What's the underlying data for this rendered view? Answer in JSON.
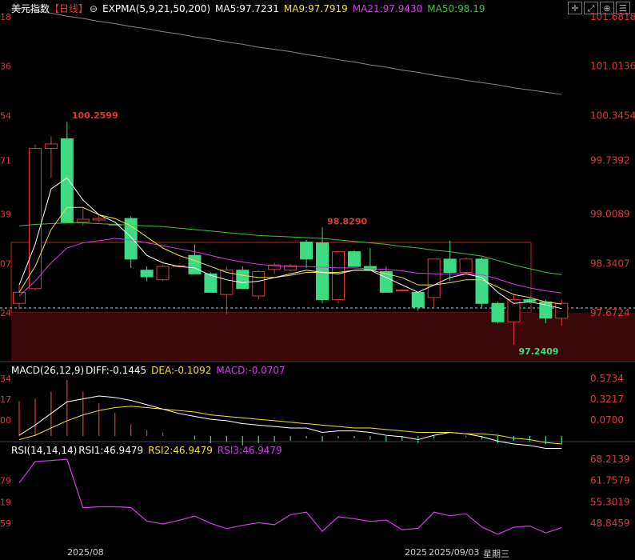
{
  "header": {
    "symbol": "美元指数",
    "period": "【日线】",
    "toggle_icon": "circle-minus-icon",
    "ema_label": "EXPMA(5,9,21,50,200)",
    "ma5": "MA5:97.7231",
    "ma9": "MA9:97.7919",
    "ma21": "MA21:97.9430",
    "ma50": "MA50:98.19"
  },
  "window_controls": {
    "icons": [
      "crosshair-icon",
      "expand-icon",
      "zoom-icon",
      "menu-icon"
    ]
  },
  "macd_header": {
    "label": "MACD(26,12,9)",
    "diff": "DIFF:-0.1445",
    "dea": "DEA:-0.1092",
    "macd": "MACD:-0.0707"
  },
  "rsi_header": {
    "label": "RSI(14,14,14)",
    "rsi1": "RSI1:46.9479",
    "rsi2": "RSI2:46.9479",
    "rsi3": "RSI3:46.9479"
  },
  "colors": {
    "up": "#e0393b",
    "down": "#3ddc84",
    "ma5": "#ffffff",
    "ma9": "#f0e040",
    "ma21": "#d040e0",
    "ma50": "#40c040",
    "ema200": "#888888",
    "axis": "#e0393b"
  },
  "chart_data": [
    {
      "type": "candlestick",
      "y_ticks": [
        "101.6818",
        "101.0136",
        "100.3454",
        "99.7392",
        "99.0089",
        "98.3407",
        "97.6724"
      ],
      "left_ticks": [
        "18",
        "36",
        "54",
        "71",
        "39",
        "07",
        "24"
      ],
      "current_price": "97.7392",
      "annotations": [
        "100.2599",
        "98.8290",
        "97.2409"
      ],
      "ohlc": [
        [
          97.8,
          98.05,
          97.72,
          97.95
        ],
        [
          98.0,
          99.95,
          97.98,
          99.9
        ],
        [
          99.9,
          100.06,
          99.5,
          99.96
        ],
        [
          100.03,
          100.26,
          98.9,
          98.9
        ],
        [
          98.9,
          99.1,
          98.85,
          98.94
        ],
        [
          98.93,
          99.0,
          98.9,
          98.95
        ],
        [
          98.86,
          98.88,
          98.86,
          98.87
        ],
        [
          98.95,
          98.98,
          98.28,
          98.4
        ],
        [
          98.25,
          98.3,
          98.1,
          98.16
        ],
        [
          98.12,
          98.32,
          98.1,
          98.3
        ],
        [
          98.3,
          98.32,
          98.29,
          98.31
        ],
        [
          98.45,
          98.6,
          98.2,
          98.2
        ],
        [
          98.2,
          98.22,
          97.95,
          97.95
        ],
        [
          97.92,
          98.3,
          97.65,
          98.25
        ],
        [
          98.25,
          98.3,
          98.0,
          98.0
        ],
        [
          97.9,
          98.25,
          97.85,
          98.23
        ],
        [
          98.26,
          98.35,
          98.2,
          98.32
        ],
        [
          98.25,
          98.33,
          98.23,
          98.31
        ],
        [
          98.63,
          98.66,
          98.28,
          98.4
        ],
        [
          98.62,
          98.83,
          97.8,
          97.85
        ],
        [
          97.85,
          98.5,
          97.8,
          98.5
        ],
        [
          98.5,
          98.52,
          98.3,
          98.3
        ],
        [
          98.3,
          98.55,
          98.25,
          98.25
        ],
        [
          98.23,
          98.3,
          97.95,
          97.95
        ],
        [
          97.97,
          97.99,
          97.96,
          97.98
        ],
        [
          97.95,
          97.95,
          97.7,
          97.75
        ],
        [
          97.88,
          98.4,
          97.75,
          98.4
        ],
        [
          98.4,
          98.65,
          98.1,
          98.22
        ],
        [
          98.22,
          98.42,
          98.2,
          98.4
        ],
        [
          98.4,
          98.42,
          97.75,
          97.8
        ],
        [
          97.8,
          97.82,
          97.53,
          97.55
        ],
        [
          97.55,
          97.93,
          97.24,
          97.85
        ],
        [
          97.85,
          97.87,
          97.8,
          97.83
        ],
        [
          97.82,
          97.85,
          97.53,
          97.6
        ],
        [
          97.6,
          97.85,
          97.5,
          97.8
        ]
      ],
      "ma5": [
        98.05,
        98.6,
        99.35,
        99.5,
        99.2,
        99.0,
        98.9,
        98.7,
        98.45,
        98.35,
        98.3,
        98.28,
        98.18,
        98.12,
        98.08,
        98.1,
        98.15,
        98.2,
        98.25,
        98.22,
        98.2,
        98.25,
        98.25,
        98.15,
        98.05,
        97.95,
        98.05,
        98.15,
        98.2,
        98.15,
        97.95,
        97.8,
        97.82,
        97.78,
        97.73
      ],
      "ma9": [
        97.95,
        98.3,
        98.8,
        99.1,
        99.1,
        99.0,
        98.95,
        98.85,
        98.7,
        98.55,
        98.45,
        98.38,
        98.3,
        98.22,
        98.18,
        98.15,
        98.15,
        98.18,
        98.22,
        98.22,
        98.22,
        98.25,
        98.25,
        98.2,
        98.15,
        98.05,
        98.05,
        98.08,
        98.12,
        98.12,
        98.02,
        97.92,
        97.88,
        97.82,
        97.79
      ],
      "ma21": [
        97.9,
        98.1,
        98.35,
        98.55,
        98.62,
        98.65,
        98.68,
        98.66,
        98.62,
        98.58,
        98.54,
        98.5,
        98.45,
        98.4,
        98.36,
        98.33,
        98.31,
        98.3,
        98.3,
        98.29,
        98.28,
        98.28,
        98.27,
        98.26,
        98.24,
        98.21,
        98.2,
        98.2,
        98.2,
        98.19,
        98.13,
        98.06,
        98.01,
        97.97,
        97.94
      ],
      "ma50": [
        98.85,
        98.87,
        98.88,
        98.89,
        98.89,
        98.88,
        98.87,
        98.86,
        98.85,
        98.84,
        98.82,
        98.8,
        98.78,
        98.76,
        98.74,
        98.72,
        98.71,
        98.7,
        98.69,
        98.68,
        98.66,
        98.64,
        98.62,
        98.6,
        98.57,
        98.55,
        98.52,
        98.5,
        98.47,
        98.44,
        98.38,
        98.32,
        98.27,
        98.22,
        98.19
      ],
      "ema200": [
        101.8,
        101.76,
        101.73,
        101.69,
        101.66,
        101.62,
        101.59,
        101.55,
        101.52,
        101.48,
        101.45,
        101.41,
        101.38,
        101.34,
        101.31,
        101.27,
        101.24,
        101.21,
        101.17,
        101.14,
        101.1,
        101.07,
        101.03,
        101.0,
        100.96,
        100.93,
        100.89,
        100.86,
        100.82,
        100.79,
        100.76,
        100.72,
        100.69,
        100.66,
        100.63
      ]
    },
    {
      "type": "macd",
      "y_ticks": [
        "0.5734",
        "0.3217",
        "0.0700"
      ],
      "left_ticks": [
        "34",
        "17",
        "00"
      ],
      "hist": [
        0.3,
        0.32,
        0.38,
        0.48,
        0.38,
        0.28,
        0.2,
        0.1,
        0.05,
        0.03,
        0.0,
        -0.03,
        -0.06,
        -0.05,
        -0.08,
        -0.06,
        -0.05,
        -0.04,
        -0.02,
        -0.05,
        -0.02,
        -0.02,
        -0.03,
        -0.05,
        -0.04,
        -0.06,
        -0.02,
        0.0,
        -0.01,
        -0.03,
        -0.06,
        -0.04,
        -0.05,
        -0.07,
        -0.07
      ],
      "diff": [
        -0.05,
        0.02,
        0.1,
        0.18,
        0.2,
        0.22,
        0.21,
        0.19,
        0.16,
        0.13,
        0.1,
        0.08,
        0.06,
        0.05,
        0.03,
        0.02,
        0.01,
        0.0,
        0.0,
        -0.03,
        -0.02,
        -0.02,
        -0.03,
        -0.05,
        -0.06,
        -0.08,
        -0.05,
        -0.03,
        -0.04,
        -0.06,
        -0.09,
        -0.11,
        -0.12,
        -0.14,
        -0.14
      ],
      "dea": [
        -0.08,
        -0.05,
        0.0,
        0.05,
        0.09,
        0.12,
        0.14,
        0.15,
        0.14,
        0.13,
        0.12,
        0.11,
        0.09,
        0.08,
        0.07,
        0.06,
        0.05,
        0.04,
        0.03,
        0.02,
        0.01,
        0.0,
        0.0,
        -0.01,
        -0.02,
        -0.03,
        -0.03,
        -0.03,
        -0.04,
        -0.04,
        -0.05,
        -0.07,
        -0.08,
        -0.1,
        -0.11
      ]
    },
    {
      "type": "line",
      "y_ticks": [
        "68.2139",
        "61.7579",
        "55.3019",
        "48.8459"
      ],
      "left_ticks": [
        "79",
        "19",
        "59"
      ],
      "rsi": [
        61.0,
        67.5,
        67.8,
        68.2,
        53.5,
        53.8,
        53.8,
        53.6,
        49.5,
        48.6,
        49.7,
        51.0,
        48.8,
        47.2,
        48.2,
        49.0,
        48.4,
        51.4,
        52.2,
        46.4,
        50.8,
        50.2,
        49.4,
        49.8,
        46.9,
        47.3,
        52.2,
        51.1,
        51.7,
        47.7,
        45.5,
        47.6,
        48.0,
        45.9,
        47.5
      ]
    }
  ],
  "x_labels": {
    "left": "2025/08",
    "right_year": "2025",
    "right_date": "2025/09/03",
    "right_weekday": "星期三"
  }
}
